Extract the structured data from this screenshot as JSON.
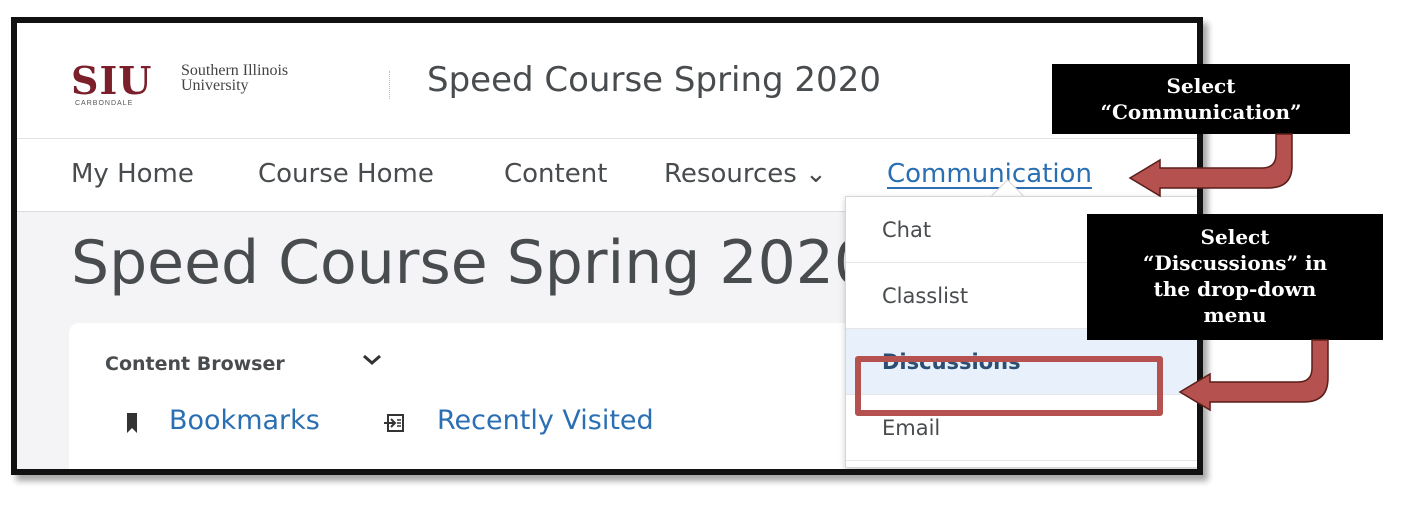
{
  "header": {
    "logo": {
      "abbr": "SIU",
      "name": "Southern Illinois\nUniversity",
      "campus": "CARBONDALE",
      "brand_color": "#7b1f2b"
    },
    "course_title": "Speed Course Spring 2020"
  },
  "navbar": {
    "items": [
      {
        "label": "My Home"
      },
      {
        "label": "Course Home"
      },
      {
        "label": "Content"
      },
      {
        "label": "Resources ⌄"
      },
      {
        "label": "Communication",
        "active": true
      }
    ]
  },
  "page": {
    "heading": "Speed Course Spring 2020"
  },
  "content_browser": {
    "title": "Content Browser",
    "chevron_icon": "chevron-down-icon",
    "links": [
      {
        "label": "Bookmarks",
        "icon": "bookmark-icon"
      },
      {
        "label": "Recently Visited",
        "icon": "recent-icon"
      }
    ]
  },
  "dropdown": {
    "items": [
      {
        "label": "Chat"
      },
      {
        "label": "Classlist"
      },
      {
        "label": "Discussions",
        "highlighted": true
      },
      {
        "label": "Email"
      }
    ]
  },
  "callouts": {
    "step1": "Select\n“Communication”",
    "step2": "Select\n“Discussions” in\nthe drop-down\nmenu"
  },
  "colors": {
    "link": "#2b6fb3",
    "highlight_border": "#b5514f",
    "arrow_fill": "#b5514f",
    "callout_bg": "#000000",
    "frame": "#111111"
  }
}
